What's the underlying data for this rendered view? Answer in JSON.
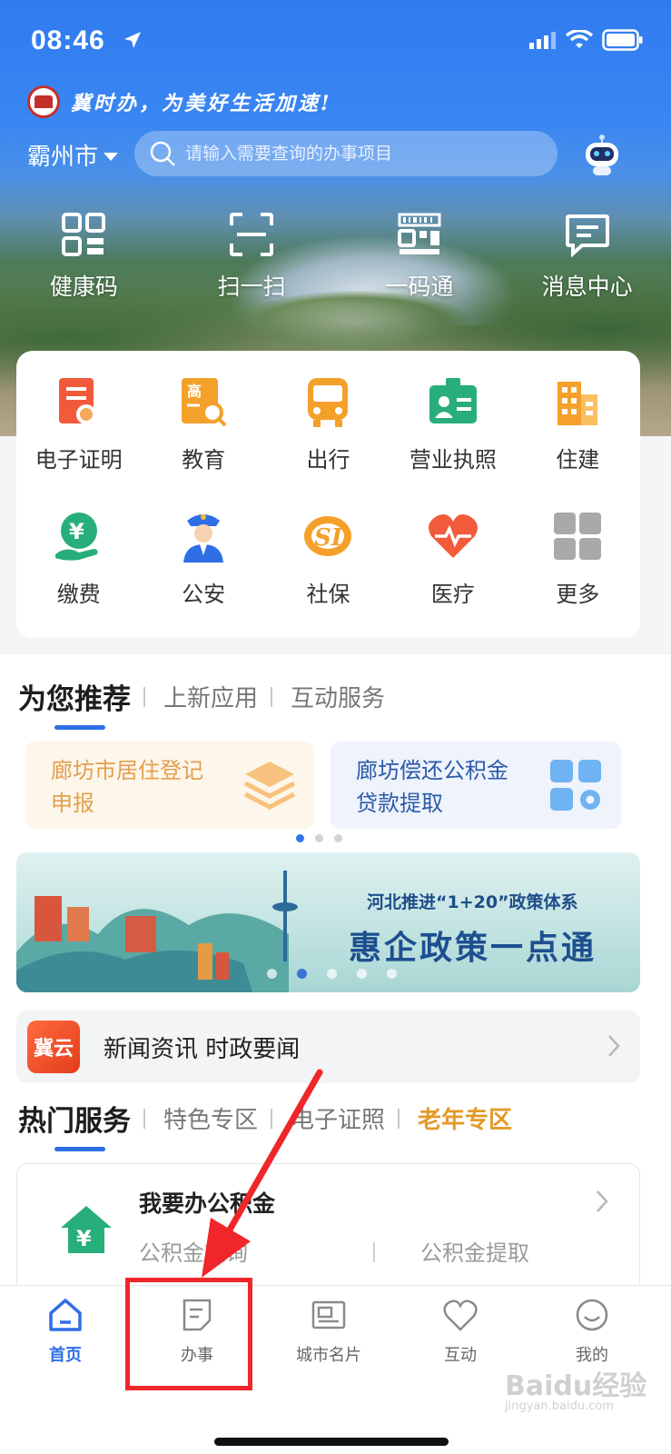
{
  "status_bar": {
    "time": "08:46"
  },
  "header": {
    "slogan": "冀时办，为美好生活加速!",
    "city": "霸州市",
    "search_placeholder": "请输入需要查询的办事项目"
  },
  "quick_actions": [
    {
      "label": "健康码",
      "icon": "health-code-icon"
    },
    {
      "label": "扫一扫",
      "icon": "scan-icon"
    },
    {
      "label": "一码通",
      "icon": "one-code-icon"
    },
    {
      "label": "消息中心",
      "icon": "message-icon"
    }
  ],
  "services": [
    {
      "label": "电子证明",
      "icon": "certificate-icon",
      "color": "#f15a3a"
    },
    {
      "label": "教育",
      "icon": "education-icon",
      "color": "#f4a02a"
    },
    {
      "label": "出行",
      "icon": "bus-icon",
      "color": "#f4a02a"
    },
    {
      "label": "营业执照",
      "icon": "license-icon",
      "color": "#27ae7a"
    },
    {
      "label": "住建",
      "icon": "building-icon",
      "color": "#f4a02a"
    },
    {
      "label": "缴费",
      "icon": "payment-icon",
      "color": "#27ae7a"
    },
    {
      "label": "公安",
      "icon": "police-icon",
      "color": "#2f6fe6"
    },
    {
      "label": "社保",
      "icon": "social-security-icon",
      "color": "#f4a02a"
    },
    {
      "label": "医疗",
      "icon": "medical-icon",
      "color": "#f15a3a"
    },
    {
      "label": "更多",
      "icon": "more-grid-icon",
      "color": "#9a9a9a"
    }
  ],
  "recommend_tabs": {
    "active": "为您推荐",
    "tab2": "上新应用",
    "tab3": "互动服务"
  },
  "recommend_cards": [
    {
      "line1": "廊坊市居住登记",
      "line2": "申报"
    },
    {
      "line1": "廊坊偿还公积金",
      "line2": "贷款提取"
    }
  ],
  "banner": {
    "subtitle": "河北推进“1+20”政策体系",
    "title": "惠企政策一点通"
  },
  "news": {
    "badge": "冀云",
    "text": "新闻资讯 时政要闻"
  },
  "hot_tabs": {
    "active": "热门服务",
    "tab2": "特色专区",
    "tab3": "电子证照",
    "tab4": "老年专区"
  },
  "hot_card": {
    "title": "我要办公积金",
    "link1": "公积金查询",
    "link2": "公积金提取"
  },
  "bottom_nav": [
    {
      "label": "首页",
      "icon": "home-icon",
      "active": true
    },
    {
      "label": "办事",
      "icon": "document-icon",
      "active": false
    },
    {
      "label": "城市名片",
      "icon": "city-card-icon",
      "active": false
    },
    {
      "label": "互动",
      "icon": "heart-icon",
      "active": false
    },
    {
      "label": "我的",
      "icon": "profile-icon",
      "active": false
    }
  ],
  "watermark": {
    "brand": "Baidu经验",
    "url": "jingyan.baidu.com"
  },
  "colors": {
    "primary": "#2f6fe6",
    "accent_gold": "#e39a2b",
    "annotation_red": "#f0262a"
  }
}
